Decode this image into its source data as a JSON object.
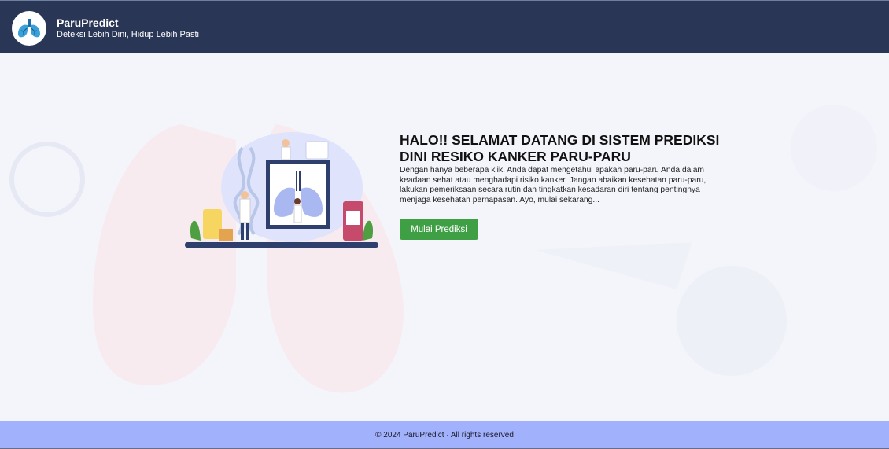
{
  "header": {
    "brand_name": "ParuPredict",
    "tagline": "Deteksi Lebih Dini, Hidup Lebih Pasti",
    "logo_icon": "lungs-icon"
  },
  "hero": {
    "headline": "HALO!! SELAMAT DATANG DI SISTEM PREDIKSI DINI RESIKO KANKER PARU-PARU",
    "description": "Dengan hanya beberapa klik, Anda dapat mengetahui apakah paru-paru Anda dalam keadaan sehat atau menghadapi risiko kanker. Jangan abaikan kesehatan paru-paru, lakukan pemeriksaan secara rutin dan tingkatkan kesadaran diri tentang pentingnya menjaga kesehatan pernapasan. Ayo, mulai sekarang...",
    "cta_label": "Mulai Prediksi",
    "illustration_icon": "lung-xray-illustration"
  },
  "footer": {
    "copyright": "© 2024 ParuPredict · All rights reserved"
  },
  "colors": {
    "header_bg": "#2a3656",
    "footer_bg": "#a2b1fb",
    "cta_bg": "#3f9f45",
    "page_bg": "#f4f5fb"
  }
}
